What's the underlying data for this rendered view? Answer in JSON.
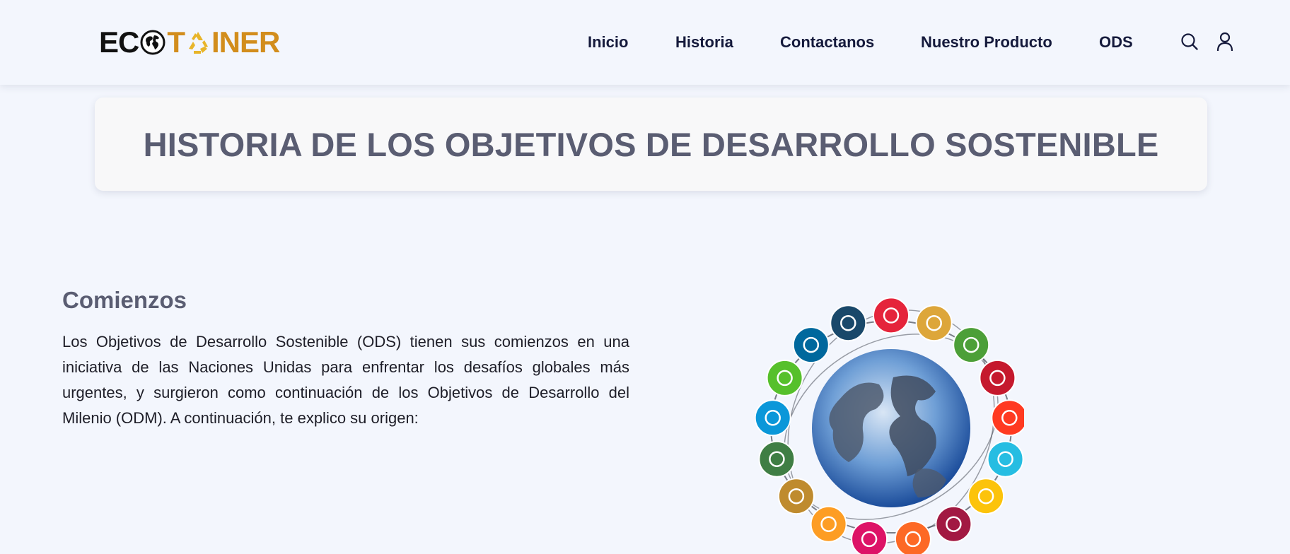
{
  "header": {
    "logo": {
      "part1": "EC",
      "part2": "T",
      "part3": "INER",
      "alt": "ECOTAINER"
    },
    "nav": [
      {
        "label": "Inicio"
      },
      {
        "label": "Historia"
      },
      {
        "label": "Contactanos"
      },
      {
        "label": "Nuestro Producto"
      },
      {
        "label": "ODS"
      }
    ],
    "icons": {
      "search": "search-icon",
      "user": "user-icon"
    }
  },
  "page": {
    "title": "HISTORIA DE LOS OBJETIVOS DE DESARROLLO SOSTENIBLE"
  },
  "section": {
    "heading": "Comienzos",
    "paragraph": "Los Objetivos de Desarrollo Sostenible (ODS) tienen sus comienzos en una iniciativa de las Naciones Unidas para enfrentar los desafíos globales más urgentes, y surgieron como continuación de los Objetivos de Desarrollo del Milenio (ODM). A continuación, te explico su origen:"
  },
  "colors": {
    "background": "#f3f6fd",
    "nav_text": "#151a3c",
    "heading": "#5a5d72",
    "logo_accent": "#d28d1c"
  },
  "sdg_image": {
    "description_icon": "sdg-globe-image",
    "goal_colors": [
      "#e5243b",
      "#dda63a",
      "#4c9f38",
      "#c5192d",
      "#ff3a21",
      "#26bde2",
      "#fcc30b",
      "#a21942",
      "#fd6925",
      "#dd1367",
      "#fd9d24",
      "#bf8b2e",
      "#3f7e44",
      "#0a97d9",
      "#56c02b",
      "#00689d",
      "#19486a"
    ]
  }
}
